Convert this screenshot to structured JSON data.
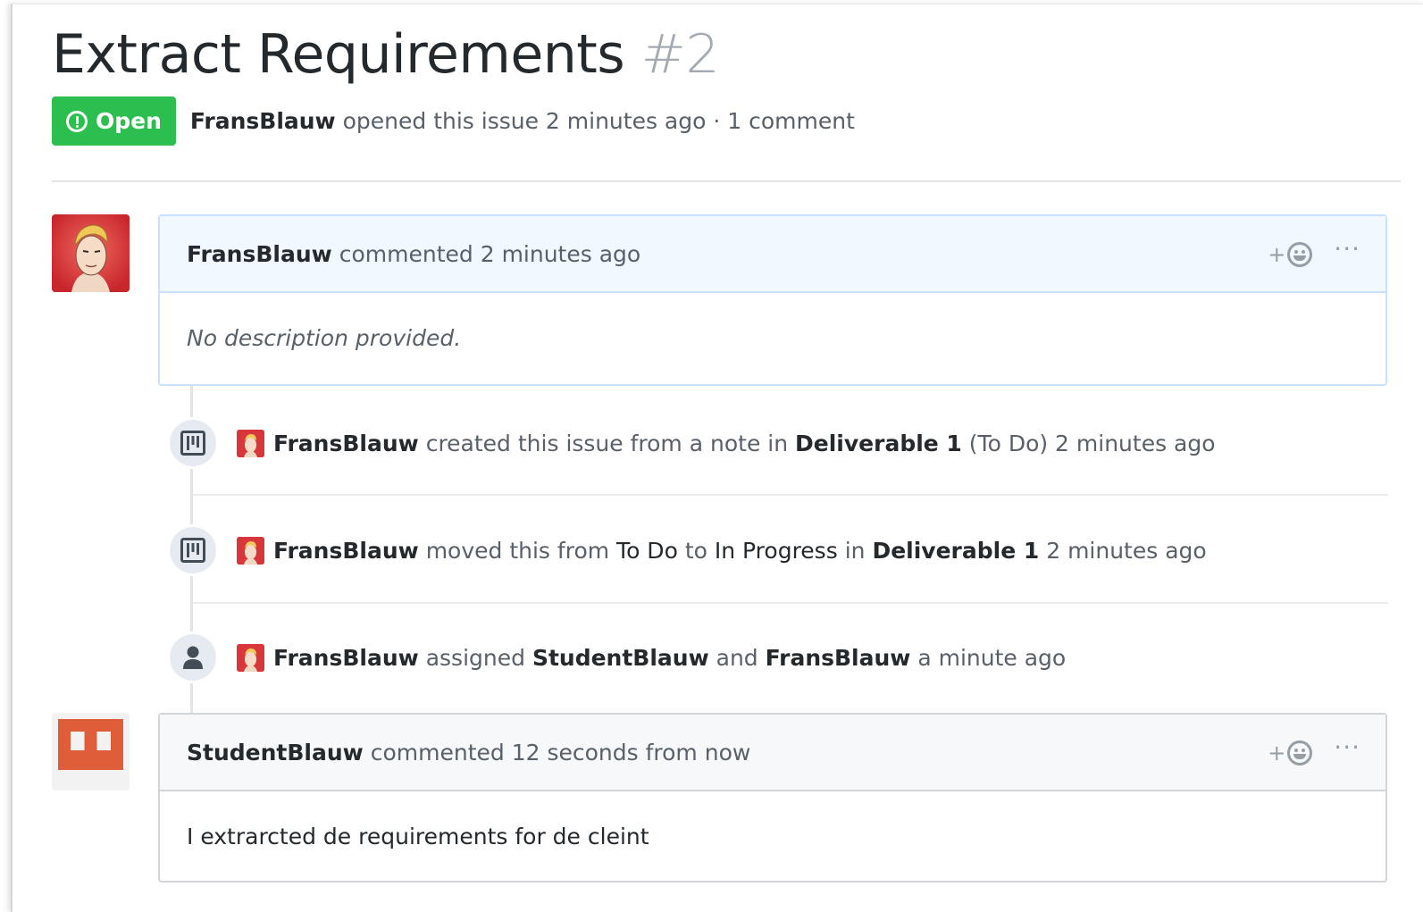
{
  "issue": {
    "title": "Extract Requirements",
    "number": "#2",
    "state": "Open",
    "author": "FransBlauw",
    "opened_text": "opened this issue 2 minutes ago · 1 comment"
  },
  "comments": [
    {
      "author": "FransBlauw",
      "action": "commented 2 minutes ago",
      "body": "No description provided.",
      "reaction_plus": "+",
      "more": "···"
    },
    {
      "author": "StudentBlauw",
      "action": "commented 12 seconds from now",
      "body": "I extrarcted de requirements for de cleint",
      "reaction_plus": "+",
      "more": "···"
    }
  ],
  "events": [
    {
      "icon": "project-icon",
      "actor": "FransBlauw",
      "t1": "created this issue from a note in",
      "b1": "Deliverable 1",
      "t2": "(To Do) 2 minutes ago"
    },
    {
      "icon": "project-icon",
      "actor": "FransBlauw",
      "t1": "moved this from",
      "d1": "To Do",
      "t2": "to",
      "d2": "In Progress",
      "t3": "in",
      "b1": "Deliverable 1",
      "t4": "2 minutes ago"
    },
    {
      "icon": "person-icon",
      "actor": "FransBlauw",
      "t1": "assigned",
      "b1": "StudentBlauw",
      "t2": "and",
      "b2": "FransBlauw",
      "t3": "a minute ago"
    }
  ],
  "colors": {
    "open_green": "#2cbe4e",
    "header_blue": "#f1f8ff",
    "avatar_red": "#d7363a",
    "identicon_orange": "#e05d3a"
  }
}
